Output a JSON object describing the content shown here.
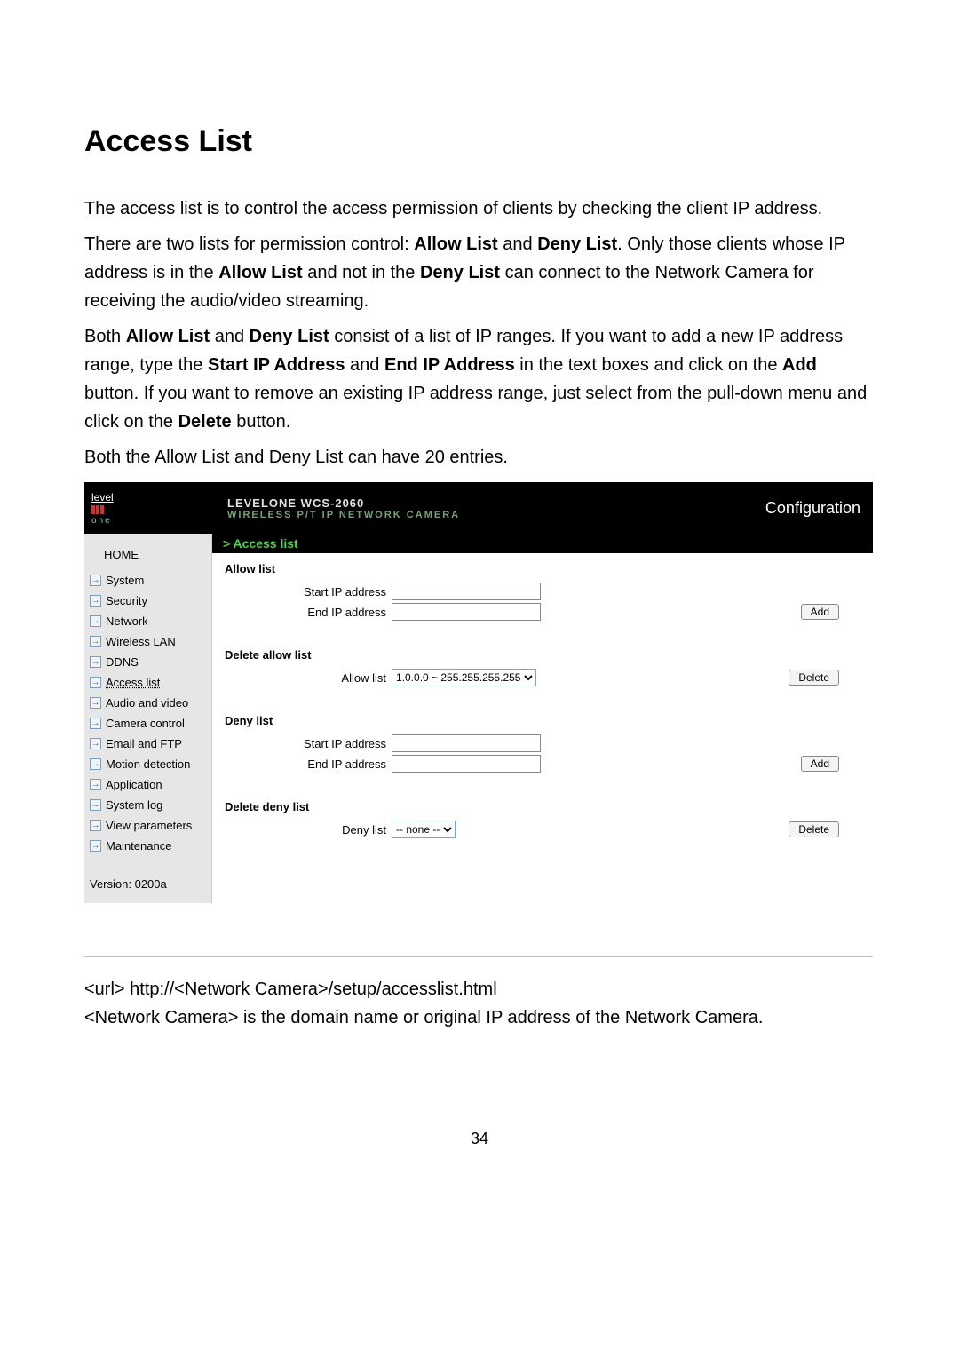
{
  "page": {
    "title": "Access List",
    "p1a": "The access list is to control the access permission of clients by checking the client IP address.",
    "p2a": "There are two lists for permission control: ",
    "p2b": "Allow List",
    "p2c": " and ",
    "p2d": "Deny List",
    "p2e": ". Only those clients whose IP address is in the ",
    "p2f": "Allow List",
    "p2g": " and not in the ",
    "p2h": "Deny List",
    "p2i": " can connect to the Network Camera for receiving the audio/video streaming.",
    "p3a": "Both ",
    "p3b": "Allow List",
    "p3c": " and ",
    "p3d": "Deny List",
    "p3e": " consist of a list of IP ranges. If you want to add a new IP address range, type the ",
    "p3f": "Start IP Address",
    "p3g": " and ",
    "p3h": "End IP Address",
    "p3i": " in the text boxes and click on the ",
    "p3j": "Add",
    "p3k": " button. If you want to remove an existing IP address range, just select from the pull-down menu and click on the ",
    "p3l": "Delete",
    "p3m": " button.",
    "p4": "Both the Allow List and Deny List can have 20 entries.",
    "foot1": "<url> http://<Network Camera>/setup/accesslist.html",
    "foot2": "<Network Camera> is the domain name or original IP address of the Network Camera.",
    "pagenum": "34"
  },
  "header": {
    "logo_top": "level",
    "logo_bottom": "one",
    "title1": "LEVELONE WCS-2060",
    "title2": "WIRELESS P/T IP NETWORK CAMERA",
    "right": "Configuration"
  },
  "nav": {
    "home": "HOME",
    "items": [
      "System",
      "Security",
      "Network",
      "Wireless LAN",
      "DDNS",
      "Access list",
      "Audio and video",
      "Camera control",
      "Email and FTP",
      "Motion detection",
      "Application",
      "System log",
      "View parameters",
      "Maintenance"
    ],
    "version": "Version: 0200a"
  },
  "main": {
    "crumb": "> Access list",
    "allow": {
      "heading": "Allow list",
      "start_label": "Start IP address",
      "end_label": "End IP address",
      "add": "Add"
    },
    "del_allow": {
      "heading": "Delete allow list",
      "label": "Allow list",
      "option": "1.0.0.0 ~ 255.255.255.255",
      "delete": "Delete"
    },
    "deny": {
      "heading": "Deny list",
      "start_label": "Start IP address",
      "end_label": "End IP address",
      "add": "Add"
    },
    "del_deny": {
      "heading": "Delete deny list",
      "label": "Deny list",
      "option": "-- none --",
      "delete": "Delete"
    }
  }
}
